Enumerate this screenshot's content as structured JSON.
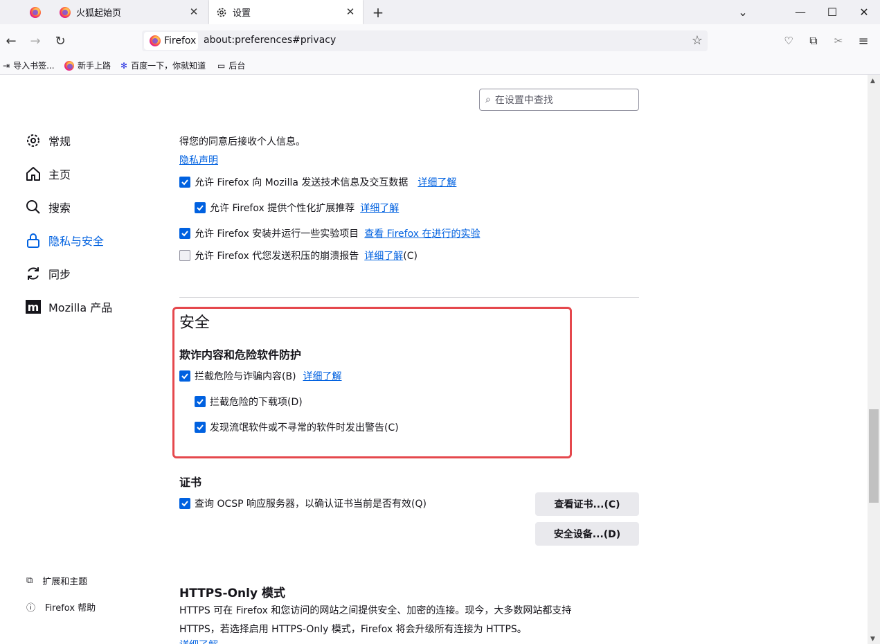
{
  "tabs": [
    {
      "label": ""
    },
    {
      "label": "火狐起始页"
    },
    {
      "label": "设置"
    }
  ],
  "new_tab": "+",
  "url": {
    "identity": "Firefox",
    "address": "about:preferences#privacy"
  },
  "bookmarks": [
    "导入书签...",
    "新手上路",
    "百度一下，你就知道",
    "后台"
  ],
  "search": {
    "placeholder": "在设置中查找"
  },
  "categories": [
    "常规",
    "主页",
    "搜索",
    "隐私与安全",
    "同步",
    "Mozilla 产品"
  ],
  "footer": [
    "扩展和主题",
    "Firefox 帮助"
  ],
  "data_collection": {
    "intro": "得您的同意后接收个人信息。",
    "privacy_link": "隐私声明",
    "opt1": "允许 Firefox 向 Mozilla 发送技术信息及交互数据",
    "opt2": "允许 Firefox 提供个性化扩展推荐",
    "opt3": "允许 Firefox 安装并运行一些实验项目",
    "opt3_link": "查看 Firefox 在进行的实验",
    "opt4": "允许 Firefox 代您发送积压的崩溃报告",
    "learn_more": "详细了解",
    "opt4_suffix": "(C)"
  },
  "security": {
    "title": "安全",
    "subtitle": "欺诈内容和危险软件防护",
    "block_dangerous": "拦截危险与诈骗内容(B)",
    "learn_more": "详细了解",
    "block_downloads": "拦截危险的下载项(D)",
    "warn_unwanted": "发现流氓软件或不寻常的软件时发出警告(C)"
  },
  "certificates": {
    "title": "证书",
    "ocsp": "查询 OCSP 响应服务器，以确认证书当前是否有效(Q)",
    "view_button": "查看证书...(C)",
    "devices_button": "安全设备...(D)"
  },
  "https_only": {
    "title": "HTTPS-Only 模式",
    "line1": "HTTPS 可在 Firefox 和您访问的网站之间提供安全、加密的连接。现今，大多数网站都支持",
    "line2": "HTTPS，若选择启用 HTTPS-Only 模式，Firefox 将会升级所有连接为 HTTPS。",
    "learn_more": "详细了解"
  },
  "colors": {
    "accent": "#0061e0",
    "highlight": "#e5484d"
  }
}
